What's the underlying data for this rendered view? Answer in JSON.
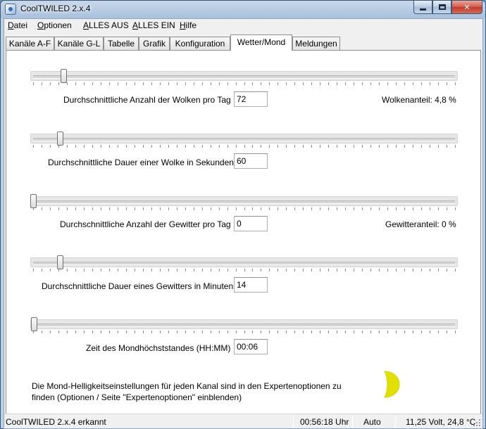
{
  "window": {
    "title": "CoolTWILED 2.x.4"
  },
  "menu": [
    {
      "label": "Datei",
      "underline": "D",
      "rest": "atei"
    },
    {
      "label": "Optionen",
      "underline": "O",
      "rest": "ptionen"
    },
    {
      "label": "ALLES AUS",
      "underline": "A",
      "rest": "LLES AUS"
    },
    {
      "label": "ALLES EIN",
      "underline": "A",
      "rest": "LLES EIN"
    },
    {
      "label": "Hilfe",
      "underline": "H",
      "rest": "ilfe"
    }
  ],
  "tabs": [
    "Kanäle A-F",
    "Kanäle G-L",
    "Tabelle",
    "Grafik",
    "Konfiguration",
    "Wetter/Mond",
    "Meldungen"
  ],
  "active_tab": "Wetter/Mond",
  "settings": {
    "clouds_per_day": {
      "label": "Durchschnittliche Anzahl der Wolken pro Tag",
      "value": "72",
      "info": "Wolkenanteil: 4,8 %"
    },
    "cloud_duration": {
      "label": "Durchschnittliche Dauer einer Wolke in Sekunden",
      "value": "60"
    },
    "storms_per_day": {
      "label": "Durchschnittliche Anzahl der Gewitter pro Tag",
      "value": "0",
      "info": "Gewitteranteil: 0 %"
    },
    "storm_duration": {
      "label": "Durchschnittliche Dauer eines Gewitters in Minuten",
      "value": "14"
    },
    "moon_peak_time": {
      "label": "Zeit des Mondhöchststandes (HH:MM)",
      "value": "00:06"
    }
  },
  "note": "Die Mond-Helligkeitseinstellungen für jeden Kanal sind in den Expertenoptionen zu finden (Optionen / Seite \"Expertenoptionen\" einblenden)",
  "status": {
    "device": "CoolTWILED 2.x.4 erkannt",
    "time": "00:56:18 Uhr",
    "mode": "Auto",
    "readings": "11,25 Volt, 24,8 °C"
  },
  "colors": {
    "moon": "#e2e000",
    "title_glass": "#a9c2dd",
    "close_button": "#c23b2a"
  },
  "icons": [
    "app-icon",
    "minimize-icon",
    "maximize-icon",
    "close-icon",
    "moon-phase-icon",
    "size-grip-icon"
  ]
}
